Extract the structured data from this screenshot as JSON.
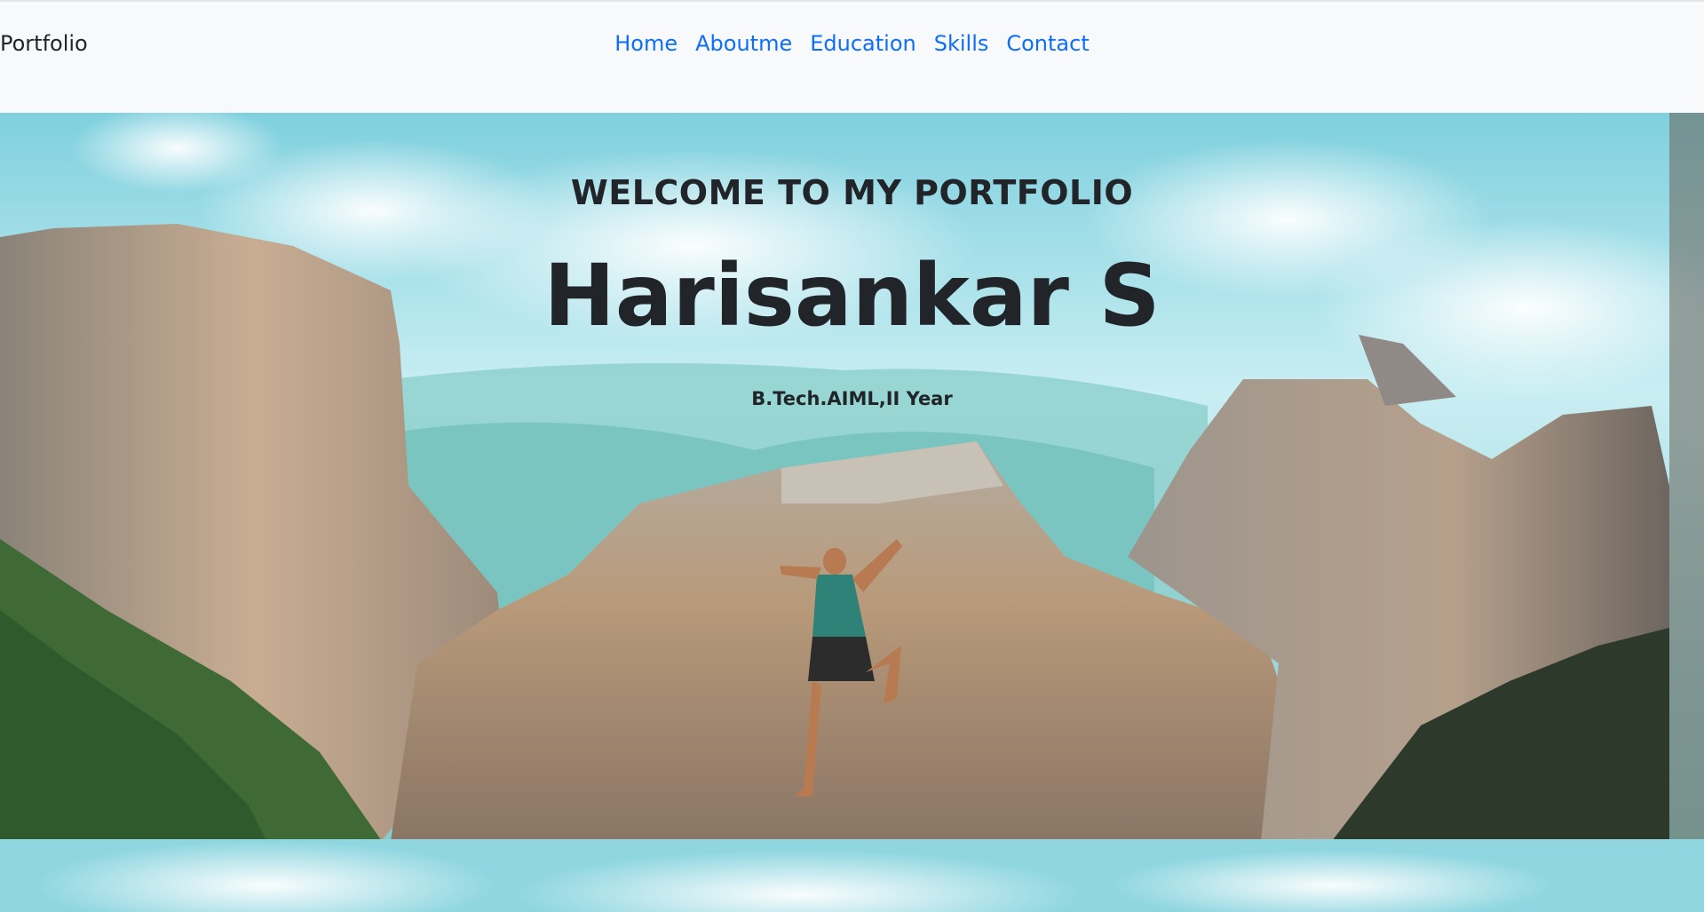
{
  "navbar": {
    "brand": "Portfolio",
    "links": [
      "Home",
      "Aboutme",
      "Education",
      "Skills",
      "Contact"
    ]
  },
  "hero": {
    "welcome": "WELCOME TO MY PORTFOLIO",
    "name": "Harisankar S",
    "subtitle": "B.Tech.AIML,II Year",
    "background": "mountain-climber-photo"
  },
  "colors": {
    "link": "#0d6efd",
    "text": "#212529",
    "navbar_bg": "#f8f9fa"
  }
}
